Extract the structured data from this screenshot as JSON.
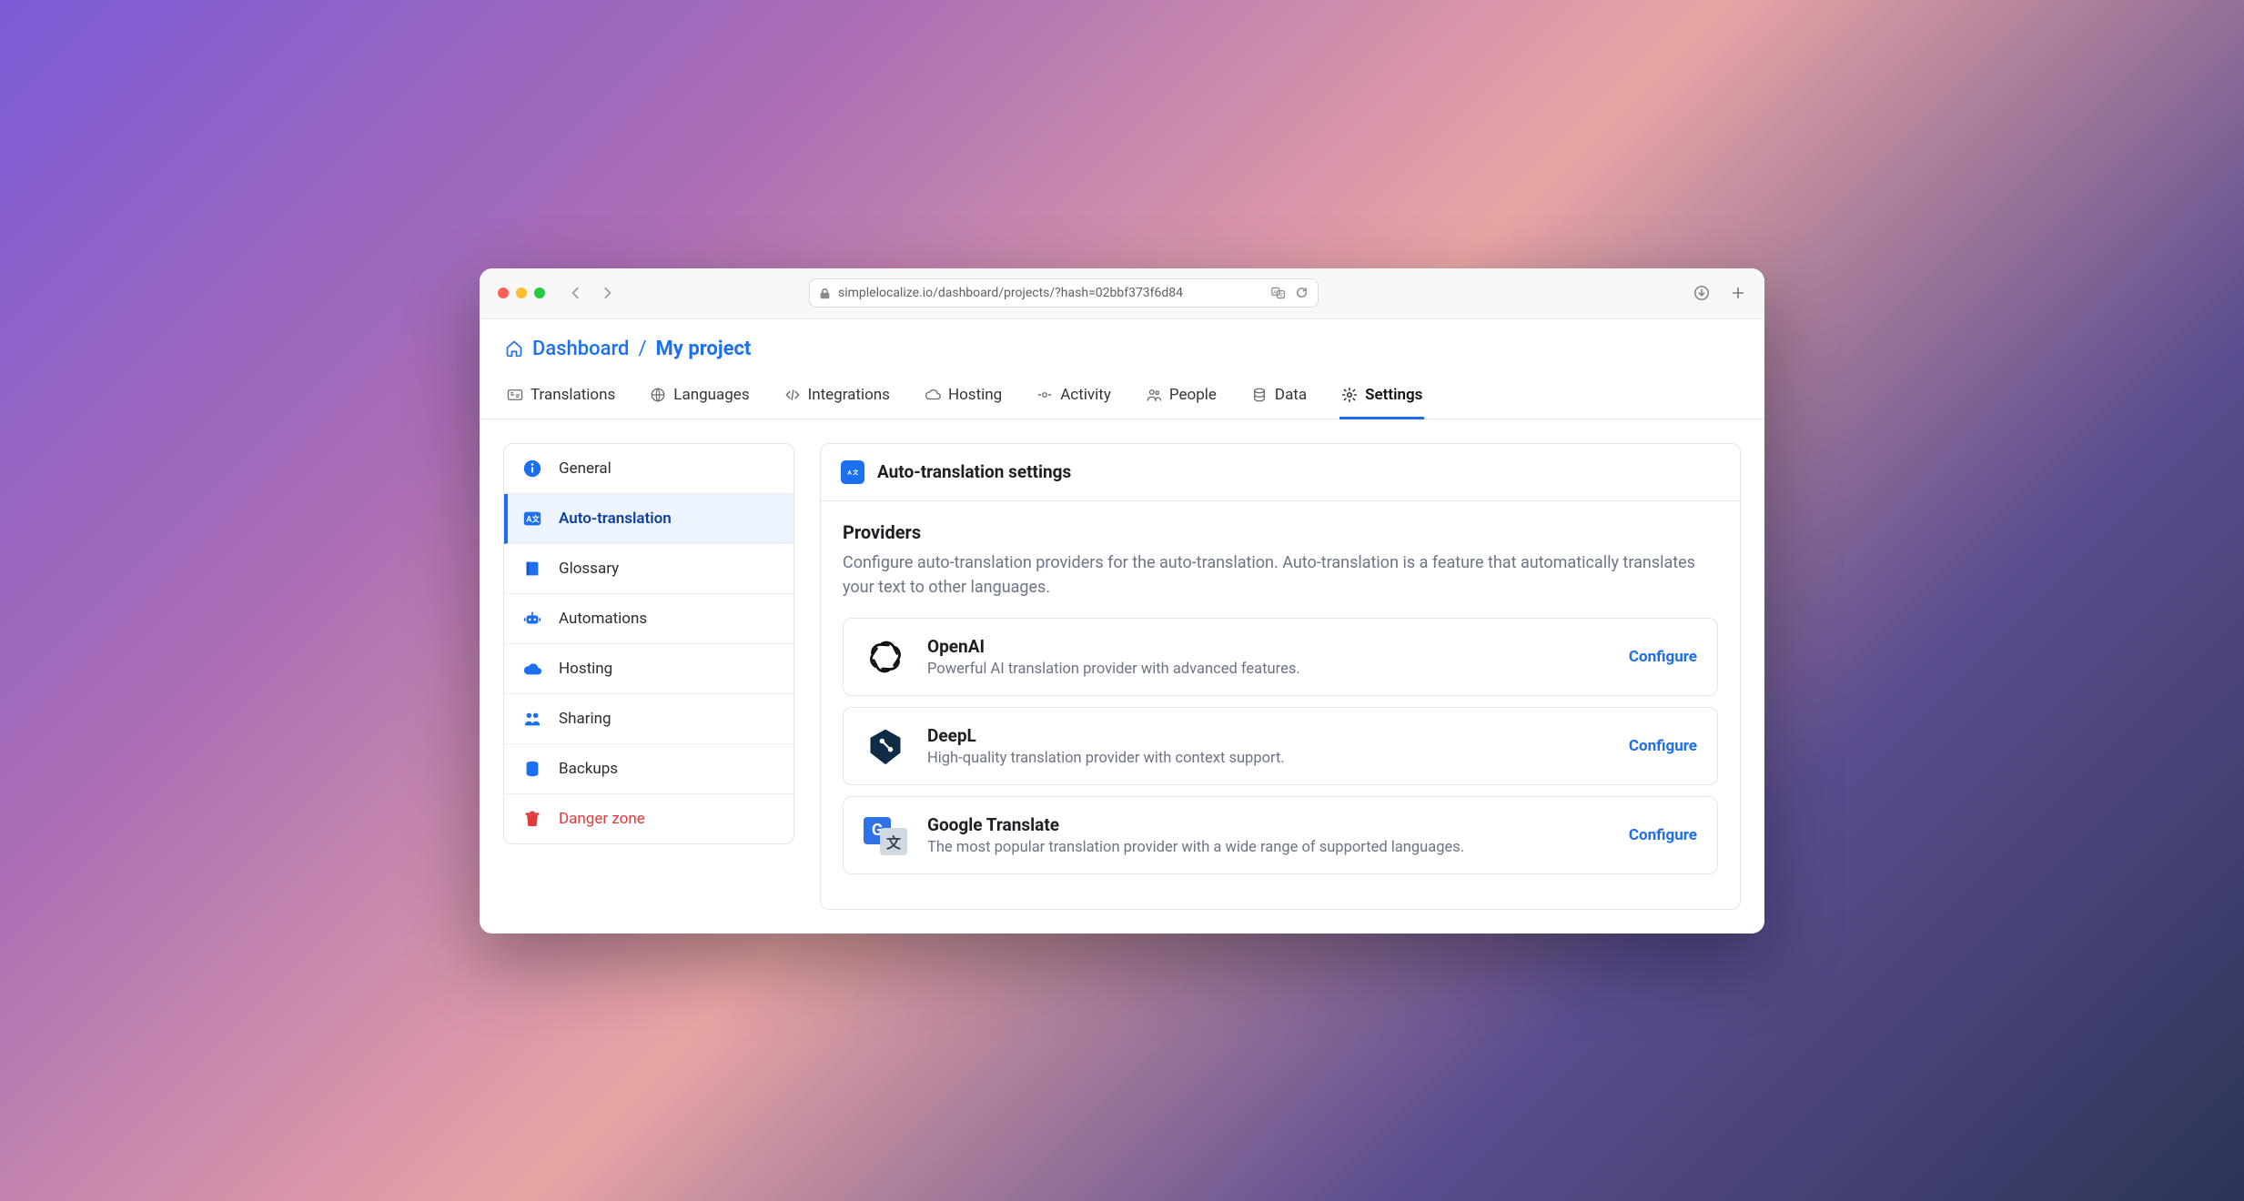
{
  "browser": {
    "url": "simplelocalize.io/dashboard/projects/?hash=02bbf373f6d84"
  },
  "breadcrumb": {
    "root": "Dashboard",
    "current": "My project"
  },
  "tabs": [
    {
      "id": "translations",
      "label": "Translations",
      "icon": "translations-icon"
    },
    {
      "id": "languages",
      "label": "Languages",
      "icon": "globe-icon"
    },
    {
      "id": "integrations",
      "label": "Integrations",
      "icon": "code-icon"
    },
    {
      "id": "hosting",
      "label": "Hosting",
      "icon": "cloud-icon"
    },
    {
      "id": "activity",
      "label": "Activity",
      "icon": "activity-icon"
    },
    {
      "id": "people",
      "label": "People",
      "icon": "people-icon"
    },
    {
      "id": "data",
      "label": "Data",
      "icon": "database-icon"
    },
    {
      "id": "settings",
      "label": "Settings",
      "icon": "gear-icon",
      "active": true
    }
  ],
  "sidebar": {
    "items": [
      {
        "id": "general",
        "label": "General",
        "icon": "info-icon"
      },
      {
        "id": "auto-translation",
        "label": "Auto-translation",
        "icon": "translate-icon",
        "active": true
      },
      {
        "id": "glossary",
        "label": "Glossary",
        "icon": "book-icon"
      },
      {
        "id": "automations",
        "label": "Automations",
        "icon": "robot-icon"
      },
      {
        "id": "hosting",
        "label": "Hosting",
        "icon": "cloud-solid-icon"
      },
      {
        "id": "sharing",
        "label": "Sharing",
        "icon": "share-icon"
      },
      {
        "id": "backups",
        "label": "Backups",
        "icon": "stack-icon"
      },
      {
        "id": "danger",
        "label": "Danger zone",
        "icon": "trash-icon",
        "danger": true
      }
    ]
  },
  "main": {
    "header_title": "Auto-translation settings",
    "section_title": "Providers",
    "section_desc": "Configure auto-translation providers for the auto-translation. Auto-translation is a feature that automatically translates your text to other languages.",
    "action_label": "Configure",
    "providers": [
      {
        "id": "openai",
        "name": "OpenAI",
        "desc": "Powerful AI translation provider with advanced features."
      },
      {
        "id": "deepl",
        "name": "DeepL",
        "desc": "High-quality translation provider with context support."
      },
      {
        "id": "google",
        "name": "Google Translate",
        "desc": "The most popular translation provider with a wide range of supported languages."
      }
    ]
  }
}
